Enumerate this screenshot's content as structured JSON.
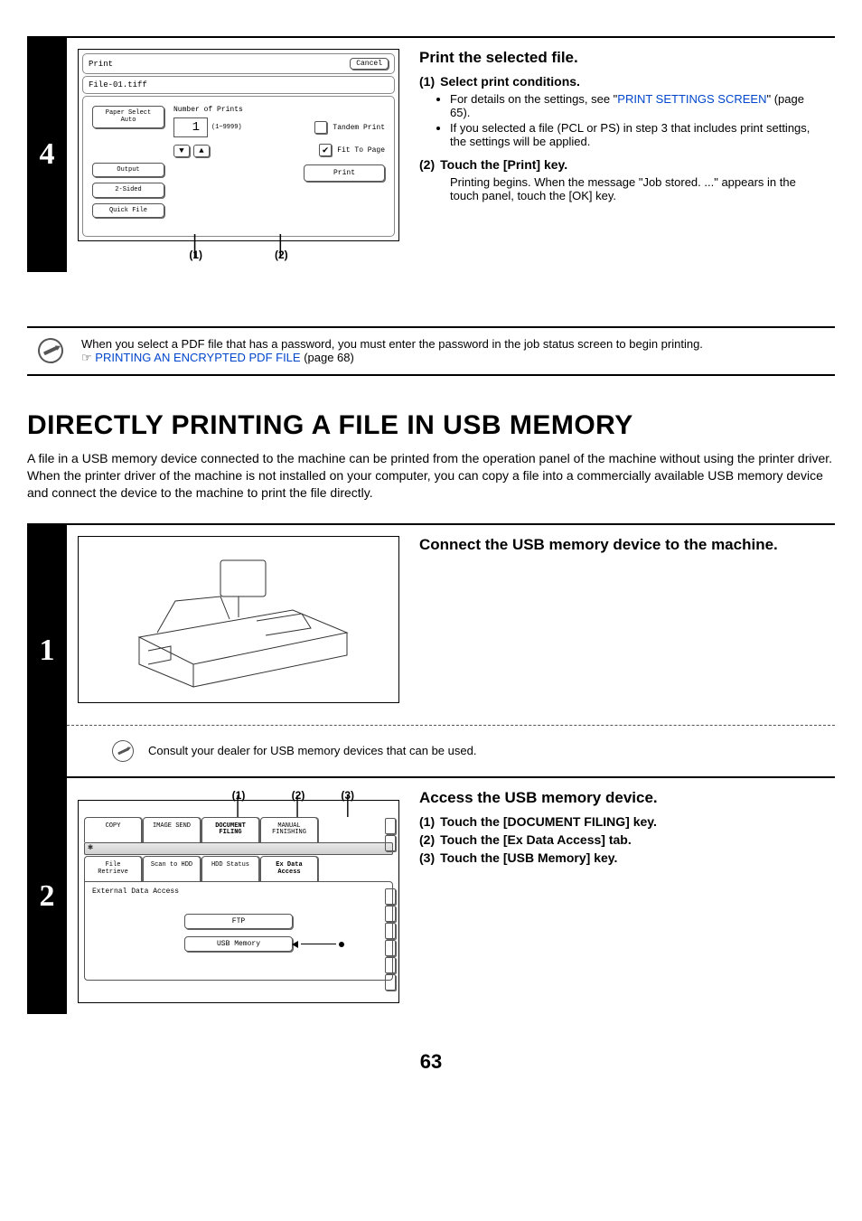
{
  "step4": {
    "num": "4",
    "panel": {
      "title": "Print",
      "cancel": "Cancel",
      "filename": "File-01.tiff",
      "paper_select": "Paper Select",
      "auto": "Auto",
      "output": "Output",
      "two_sided": "2-Sided",
      "quick_file": "Quick File",
      "num_prints_label": "Number of Prints",
      "count": "1",
      "range": "(1~9999)",
      "tandem": "Tandem Print",
      "fit_to_page": "Fit To Page",
      "print_btn": "Print",
      "c1": "(1)",
      "c2": "(2)"
    },
    "heading": "Print the selected file.",
    "s1_num": "(1)",
    "s1_title": "Select print conditions.",
    "s1_b1_a": "For details on the settings, see \"",
    "s1_b1_link": "PRINT SETTINGS SCREEN",
    "s1_b1_b": "\" (page 65).",
    "s1_b2": "If you selected a file (PCL or PS) in step 3 that includes print settings, the settings will be applied.",
    "s2_num": "(2)",
    "s2_title": "Touch the [Print] key.",
    "s2_body": "Printing begins. When the message \"Job stored. ...\" appears in the touch panel, touch the [OK] key."
  },
  "note": {
    "line1": "When you select a PDF file that has a password, you must enter the password in the job status screen to begin printing.",
    "pointer": "☞",
    "link": "PRINTING AN ENCRYPTED PDF FILE",
    "tail": " (page 68)"
  },
  "h1": "DIRECTLY PRINTING A FILE IN USB MEMORY",
  "intro": "A file in a USB memory device connected to the machine can be printed from the operation panel of the machine without using the printer driver. When the printer driver of the machine is not installed on your computer, you can copy a file into a commercially available USB memory device and connect the device to the machine to print the file directly.",
  "step1": {
    "num": "1",
    "heading": "Connect the USB memory device to the machine.",
    "consult": "Consult your dealer for USB memory devices that can be used."
  },
  "step2": {
    "num": "2",
    "callouts": {
      "c1": "(1)",
      "c2": "(2)",
      "c3": "(3)"
    },
    "panel": {
      "tabs_top": [
        "COPY",
        "IMAGE SEND",
        "DOCUMENT\nFILING",
        "MANUAL\nFINISHING"
      ],
      "tabs_mid": [
        "File Retrieve",
        "Scan to HDD",
        "HDD Status",
        "Ex Data Access"
      ],
      "body_label": "External Data Access",
      "ftp": "FTP",
      "usb": "USB Memory"
    },
    "heading": "Access the USB memory device.",
    "s1": "Touch the [DOCUMENT FILING] key.",
    "s2": "Touch the [Ex Data Access] tab.",
    "s3": "Touch the [USB Memory] key.",
    "n1": "(1)",
    "n2": "(2)",
    "n3": "(3)"
  },
  "page": "63"
}
